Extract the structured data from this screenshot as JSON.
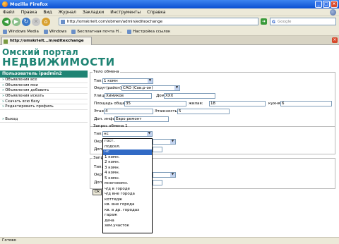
{
  "window": {
    "title": "Mozilla Firefox"
  },
  "menu": [
    "Файл",
    "Правка",
    "Вид",
    "Журнал",
    "Закладки",
    "Инструменты",
    "Справка"
  ],
  "nav": {
    "url": "http://omskrielt.com/obmen/admin/editexchange",
    "search_placeholder": "Google"
  },
  "bookmarks": [
    "Windows Media",
    "Windows",
    "Бесплатная почта H...",
    "Настройка ссылок"
  ],
  "tab": {
    "label": "http://omskrielt...in/editexchange"
  },
  "logo": {
    "line1": "Омский портал",
    "line2": "НЕДВИЖИМОСТИ"
  },
  "sidebar": {
    "header": "Пользователь ipadmin2",
    "items": [
      "Объявления все",
      "Объявления мои",
      "Объявления добавить",
      "Объявления искать",
      "Скачать всю базу",
      "Редактировать профиль"
    ],
    "logout": "Выход"
  },
  "exchange": {
    "legend": "Тело обмена",
    "type_label": "Тип:",
    "type_value": "1 комн",
    "district_label": "Округ(район):",
    "district_value": "САО (Сов.р-он)",
    "street_label": "Улица:",
    "street_value": "Химиков",
    "house_label": "Дом:",
    "house_value": "XXX",
    "area_label": "Площадь общая:",
    "area_value": "35",
    "living_label": "жилая:",
    "living_value": "18",
    "kitchen_label": "кухня:",
    "kitchen_value": "6",
    "floor_label": "Этаж:",
    "floor_value": "4",
    "floors_label": "Этажность:",
    "floors_value": "5",
    "info_label": "Доп. инфо:",
    "info_value": "Евро ремонт"
  },
  "request1": {
    "legend": "Запрос обмена 1",
    "type_label": "Тип:",
    "type_value": "нс",
    "district_label": "Окру",
    "info_label": "Доп."
  },
  "request2": {
    "legend": "Запр",
    "type_label": "Тип:",
    "district_label": "Окру",
    "info_label": "Доп."
  },
  "ok_label": "Ok",
  "dropdown_options": [
    "гост.",
    "подсел.",
    "нс",
    "1 комн.",
    "2 комн.",
    "3 комн.",
    "4 комн.",
    "5 комн.",
    "многокомн.",
    "ч/д в городе",
    "ч/д вне города",
    "коттедж",
    "кв. вне города",
    "кв. в др. городах",
    "гараж",
    "дача",
    "зем.участок"
  ],
  "dropdown_selected_index": 2,
  "status": "Готово"
}
